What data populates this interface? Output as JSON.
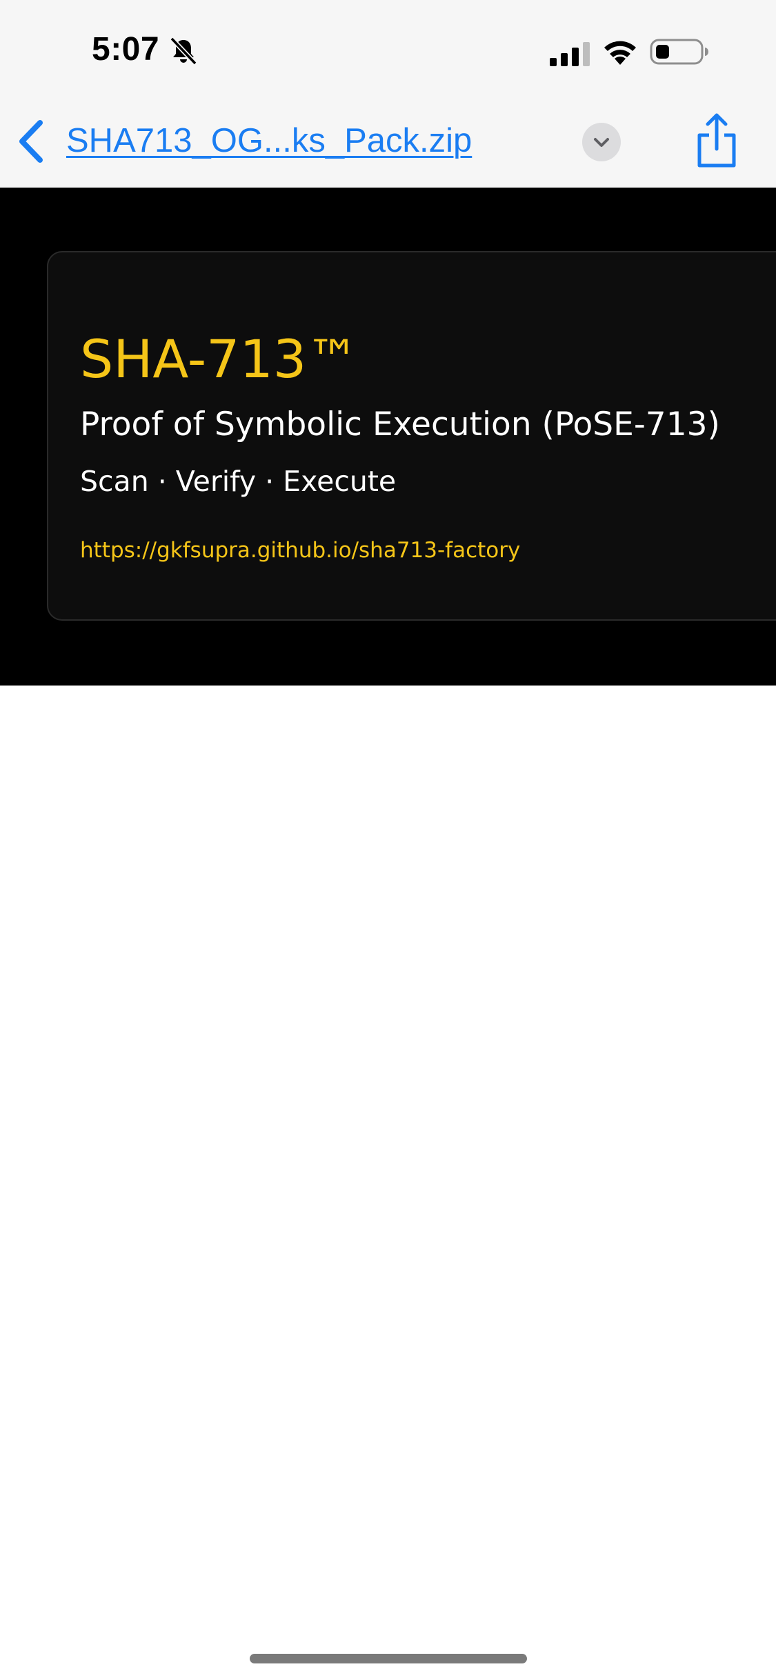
{
  "status_bar": {
    "time": "5:07",
    "icons": [
      "bell-slash-icon",
      "cellular-signal-icon",
      "wifi-icon",
      "battery-icon"
    ]
  },
  "nav": {
    "back_icon": "chevron-left-icon",
    "title": "SHA713_OG...ks_Pack.zip",
    "dropdown_icon": "chevron-down-icon",
    "share_icon": "share-icon",
    "accent_color": "#1a7df2"
  },
  "card": {
    "title": "SHA-713™",
    "subtitle": "Proof of Symbolic Execution (PoSE-713)",
    "tagline": "Scan · Verify · Execute",
    "link": "https://gkfsupra.github.io/sha713-factory",
    "accent_color": "#f5c518",
    "background_color": "#000000"
  }
}
